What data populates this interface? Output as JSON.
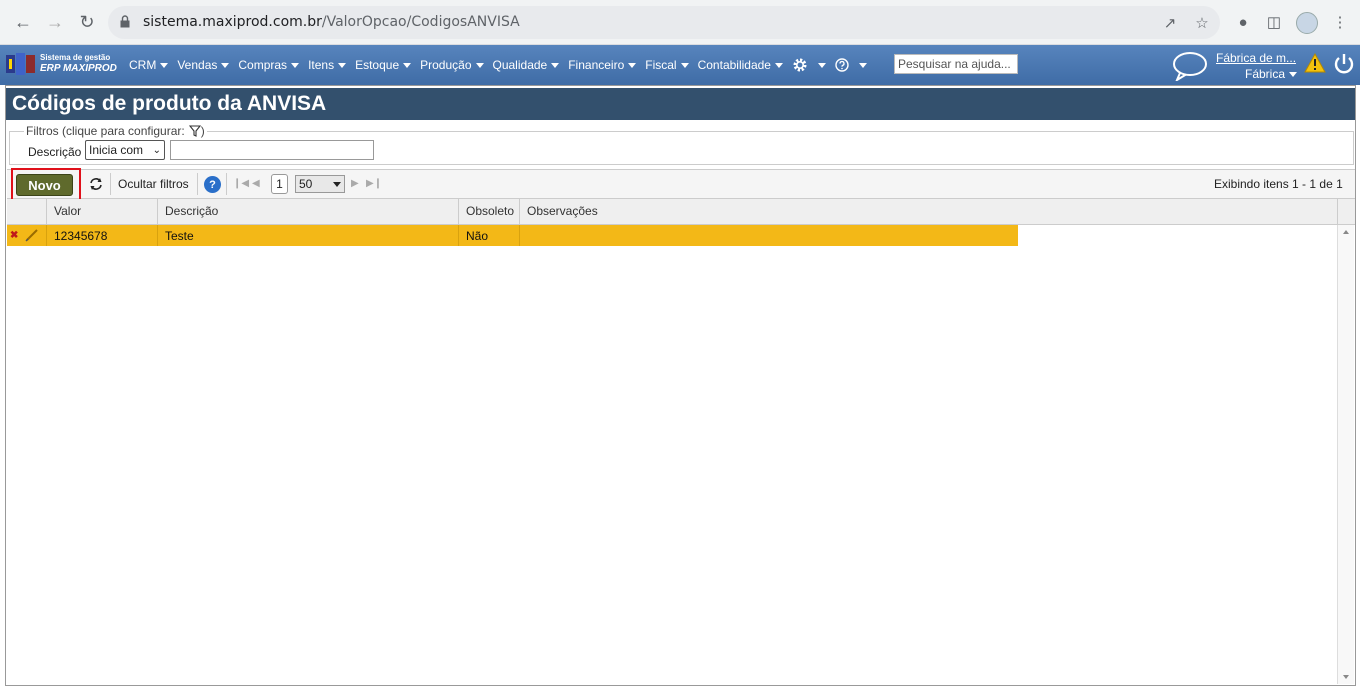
{
  "browser": {
    "url_host": "sistema.maxiprod.com.br",
    "url_path": "/ValorOpcao/CodigosANVISA"
  },
  "app": {
    "logo_line1": "Sistema de gestão",
    "logo_line2": "ERP MAXIPROD",
    "menu": [
      "CRM",
      "Vendas",
      "Compras",
      "Itens",
      "Estoque",
      "Produção",
      "Qualidade",
      "Financeiro",
      "Fiscal",
      "Contabilidade"
    ],
    "search_placeholder": "Pesquisar na ajuda...",
    "company_name": "Fábrica de m...",
    "company_sub": "Fábrica"
  },
  "page": {
    "title": "Códigos de produto da ANVISA",
    "filters_legend": "Filtros (clique para configurar:",
    "filters_legend_end": ")",
    "filter_label": "Descrição",
    "filter_mode": "Inicia com",
    "filter_value": ""
  },
  "toolbar": {
    "new_label": "Novo",
    "hide_filters_label": "Ocultar filtros",
    "help_label": "?",
    "current_page": "1",
    "page_size": "50",
    "items_info": "Exibindo itens 1 - 1 de 1"
  },
  "grid": {
    "columns": [
      "Valor",
      "Descrição",
      "Obsoleto",
      "Observações"
    ],
    "rows": [
      {
        "valor": "12345678",
        "descricao": "Teste",
        "obsoleto": "Não",
        "observacoes": ""
      }
    ]
  },
  "colors": {
    "menu_bar": "#4a78b4",
    "title_bar": "#33506d",
    "selected_row": "#f3b817",
    "new_button": "#5f6a2c",
    "highlight": "#e0101a"
  }
}
